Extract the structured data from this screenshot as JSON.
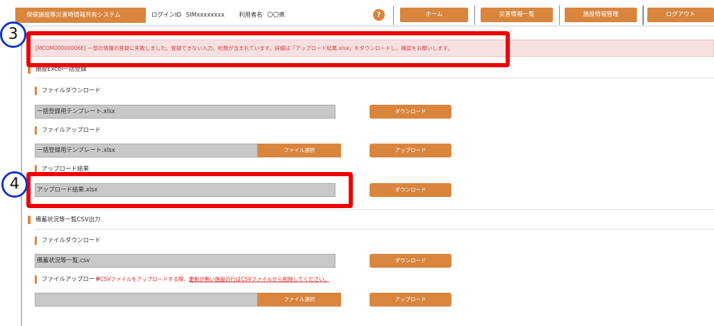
{
  "header": {
    "system_title": "保健施設等災害時情報共有システム",
    "login_label": "ログインID",
    "login_id": "SIMxxxxxxxx",
    "user_label": "利用者名",
    "user_name": "〇〇県",
    "help_icon": "?",
    "nav": {
      "home": "ホーム",
      "disaster_list": "災害情報一覧",
      "facility_mgmt": "施設情報管理",
      "logout": "ログアウト"
    }
  },
  "error_message": "[MCOM00000006E] 一部の情報の登録に失敗しました。登録できない入力、桁数が含まれています。詳細は「アップロード結果.xlsx」をダウンロードし、確認をお願いします。",
  "excel_section": {
    "title": "施設Excel一括登録",
    "download": {
      "label": "ファイルダウンロード",
      "file": "一括登録用テンプレート.xlsx",
      "button": "ダウンロード"
    },
    "upload": {
      "label": "ファイルアップロード",
      "file": "一括登録用テンプレート.xlsx",
      "select_button": "ファイル選択",
      "button": "アップロード"
    },
    "result": {
      "label": "アップロード結果",
      "file": "アップロード結果.xlsx",
      "button": "ダウンロード"
    }
  },
  "csv_section": {
    "title": "備蓄状況等一覧CSV出力",
    "download": {
      "label": "ファイルダウンロード",
      "file": "備蓄状況等一覧.csv",
      "button": "ダウンロード"
    },
    "upload": {
      "label": "ファイルアップロード",
      "note_prefix": "※CSVファイルをアップロードする際、",
      "note_underline": "更新が無い施設の行はCSVファイルから削除してください。",
      "file": "",
      "select_button": "ファイル選択",
      "button": "アップロード"
    }
  },
  "annotations": {
    "callout_3": "3",
    "callout_4": "4",
    "highlight_color": "#ee0000",
    "circle_color": "#1033cc"
  },
  "colors": {
    "accent": "#d9853e",
    "error_text": "#c9484e",
    "error_bg": "#f7e0e0"
  }
}
